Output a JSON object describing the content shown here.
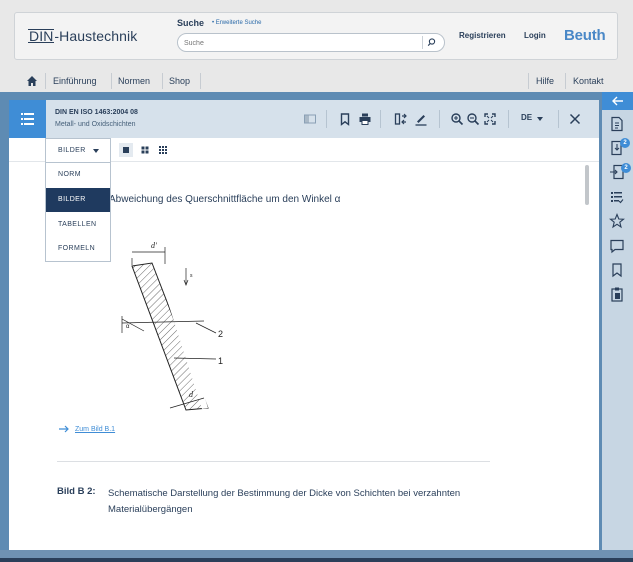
{
  "header": {
    "logo_din": "DIN",
    "logo_rest": "-Haustechnik",
    "search_label": "Suche",
    "advanced_search": "• Erweiterte Suche",
    "search_placeholder": "Suche",
    "register": "Registrieren",
    "login": "Login",
    "brand": "Beuth"
  },
  "nav": {
    "items": [
      "Einführung",
      "Normen",
      "Shop"
    ],
    "right_items": [
      "Hilfe",
      "Kontakt"
    ]
  },
  "viewer": {
    "doc_id": "DIN EN ISO 1463:2004 08",
    "doc_subtitle": "Metall- und Oxidschichten",
    "language": "DE",
    "dropdown": {
      "selected": "BILDER",
      "options": [
        "NORM",
        "BILDER",
        "TABELLEN",
        "FORMELN"
      ]
    },
    "figure_title": "Abweichung des Querschnittfläche um den Winkel α",
    "figure_labels": {
      "d_prime": "d'",
      "d": "d",
      "s": "s",
      "alpha": "α",
      "num1": "1",
      "num2": "2"
    },
    "figure_link": "Zum Bild B.1",
    "caption_label": "Bild B 2:",
    "caption_text": "Schematische Darstellung der Bestimmung der Dicke von Schichten bei verzahnten Materialübergängen"
  },
  "sidebar": {
    "badge_1": "2",
    "badge_2": "2"
  },
  "colors": {
    "primary_blue": "#3f8dd6",
    "navy": "#2a3f5a",
    "toolbar_bg": "#d6e1eb",
    "frame_blue": "#5e8bb3",
    "brand_blue": "#4a88c7"
  }
}
